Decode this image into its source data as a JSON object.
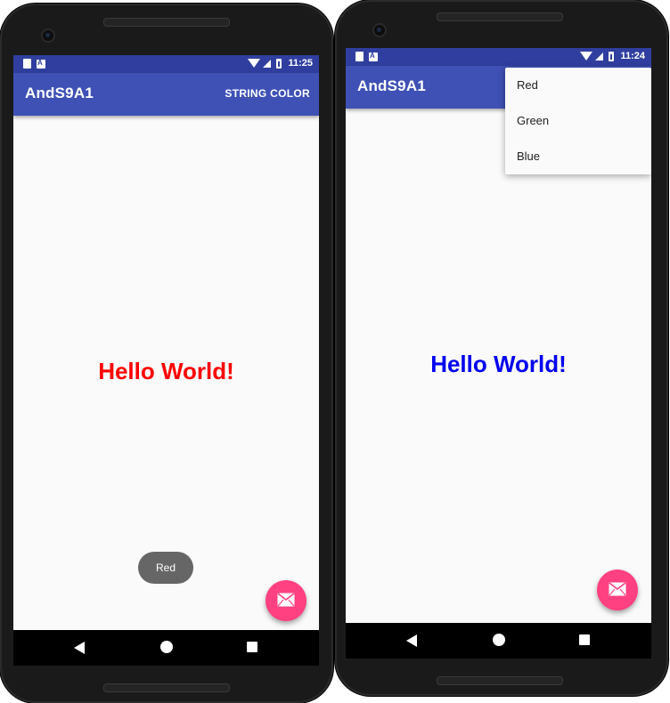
{
  "colors": {
    "status_bar": "#303f9f",
    "app_bar": "#3f51b5",
    "fab": "#ff4081",
    "hello_red": "#ff0000",
    "hello_blue": "#0000ee",
    "toast": "#666666"
  },
  "left_phone": {
    "status": {
      "time": "11:25"
    },
    "app_bar": {
      "title": "AndS9A1",
      "action": "STRING COLOR"
    },
    "hello_text": "Hello World!",
    "hello_color": "red",
    "toast": "Red",
    "fab_icon": "mail-icon",
    "nav": [
      "back-icon",
      "home-icon",
      "recents-icon"
    ]
  },
  "right_phone": {
    "status": {
      "time": "11:24"
    },
    "app_bar": {
      "title": "AndS9A1"
    },
    "menu": {
      "items": [
        "Red",
        "Green",
        "Blue"
      ]
    },
    "hello_text": "Hello World!",
    "hello_color": "blue",
    "fab_icon": "mail-icon",
    "nav": [
      "back-icon",
      "home-icon",
      "recents-icon"
    ]
  }
}
